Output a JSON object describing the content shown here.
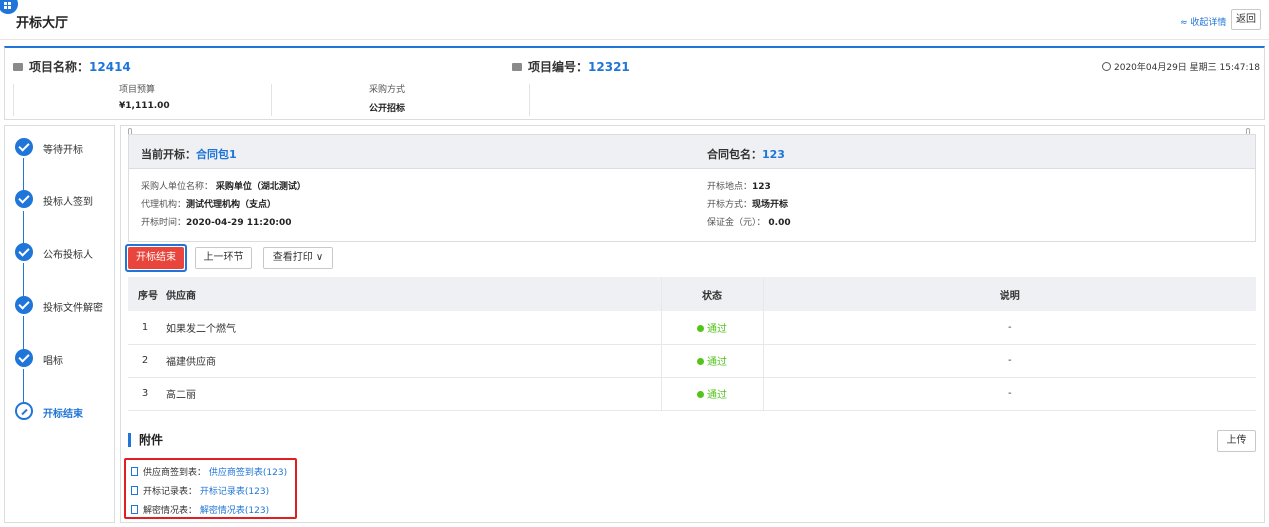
{
  "header": {
    "title": "开标大厅",
    "collapse_label": "收起详情",
    "collapse_arrow": "≈",
    "back_label": "返回"
  },
  "project": {
    "name_label": "项目名称：",
    "name_value": "12414",
    "code_label": "项目编号：",
    "code_value": "12321",
    "datetime": "2020年04月29日 星期三 15:47:18",
    "budget_label": "项目预算",
    "budget_value": "¥1,111.00",
    "method_label": "采购方式",
    "method_value": "公开招标"
  },
  "steps": [
    {
      "label": "等待开标",
      "state": "done"
    },
    {
      "label": "投标人签到",
      "state": "done"
    },
    {
      "label": "公布投标人",
      "state": "done"
    },
    {
      "label": "投标文件解密",
      "state": "done"
    },
    {
      "label": "唱标",
      "state": "done"
    },
    {
      "label": "开标结束",
      "state": "active"
    }
  ],
  "bid": {
    "current_label": "当前开标：",
    "current_value": "合同包1",
    "package_label": "合同包名：",
    "package_value": "123",
    "purchaser_label": "采购人单位名称：",
    "purchaser_value": "采购单位（湖北测试）",
    "agency_label": "代理机构：",
    "agency_value": "测试代理机构（支点）",
    "time_label": "开标时间：",
    "time_value": "2020-04-29 11:20:00",
    "location_label": "开标地点：",
    "location_value": "123",
    "mode_label": "开标方式：",
    "mode_value": "现场开标",
    "deposit_label": "保证金（元）：",
    "deposit_value": "0.00"
  },
  "actions": {
    "end_label": "开标结束",
    "prev_label": "上一环节",
    "print_label": "查看打印 ∨"
  },
  "table": {
    "headers": [
      "序号",
      "供应商",
      "状态",
      "说明"
    ],
    "rows": [
      {
        "no": "1",
        "supplier": "如果发二个燃气",
        "status": "通过",
        "note": "-"
      },
      {
        "no": "2",
        "supplier": "福建供应商",
        "status": "通过",
        "note": "-"
      },
      {
        "no": "3",
        "supplier": "高二丽",
        "status": "通过",
        "note": "-"
      }
    ]
  },
  "attachments": {
    "title": "附件",
    "upload_label": "上传",
    "items": [
      {
        "label": "供应商签到表：",
        "link": "供应商签到表(123)"
      },
      {
        "label": "开标记录表：",
        "link": "开标记录表(123)"
      },
      {
        "label": "解密情况表：",
        "link": "解密情况表(123)"
      }
    ]
  }
}
